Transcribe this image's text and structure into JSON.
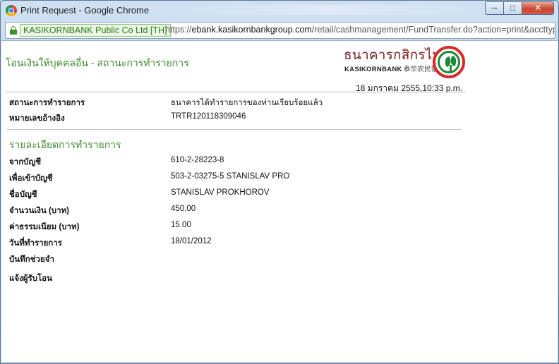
{
  "window": {
    "title": "Print Request - Google Chrome",
    "controls": {
      "minimize": "─",
      "maximize": "□",
      "close": "✕"
    }
  },
  "address_bar": {
    "certificate": "KASIKORNBANK Public Co Ltd [TH]",
    "url_scheme": "https://",
    "url_host": "ebank.kasikornbankgroup.com",
    "url_path": "/retail/cashmanagement/FundTransfer.do?action=print&accttype="
  },
  "page": {
    "title": "โอนเงินให้บุคคลอื่น - สถานะการทำรายการ",
    "logo": {
      "thai_name": "ธนาคารกสิกรไทย",
      "english_name": "KASIKORNBANK",
      "chinese_name": "泰华农民银行"
    },
    "timestamp": "18 มกราคม 2555,10:33 p.m.",
    "status_rows": [
      {
        "label": "สถานะการทำรายการ",
        "value": "ธนาคารได้ทำรายการของท่านเรียบร้อยแล้ว"
      },
      {
        "label": "หมายเลขอ้างอิง",
        "value": "TRTR120118309046"
      }
    ],
    "details_title": "รายละเอียดการทำรายการ",
    "detail_rows": [
      {
        "label": "จากบัญชี",
        "value": "610-2-28223-8"
      },
      {
        "label": "เพื่อเข้าบัญชี",
        "value": "503-2-03275-5 STANISLAV PRO"
      },
      {
        "label": "ชื่อบัญชี",
        "value": "STANISLAV PROKHOROV"
      },
      {
        "label": "จำนวนเงิน (บาท)",
        "value": "450.00"
      },
      {
        "label": "ค่าธรรมเนียม (บาท)",
        "value": "15.00"
      },
      {
        "label": "วันที่ทำรายการ",
        "value": "18/01/2012"
      },
      {
        "label": "บันทึกช่วยจำ",
        "value": ""
      },
      {
        "label": "แจ้งผู้รับโอน",
        "value": ""
      }
    ]
  },
  "colors": {
    "heading_green": "#3f8c2f",
    "logo_red": "#d82a2a",
    "logo_green": "#1d8a3a"
  },
  "icons": {
    "app": "chrome-icon",
    "security": "lock-icon",
    "bank_logo": "kasikorn-logo-icon"
  }
}
